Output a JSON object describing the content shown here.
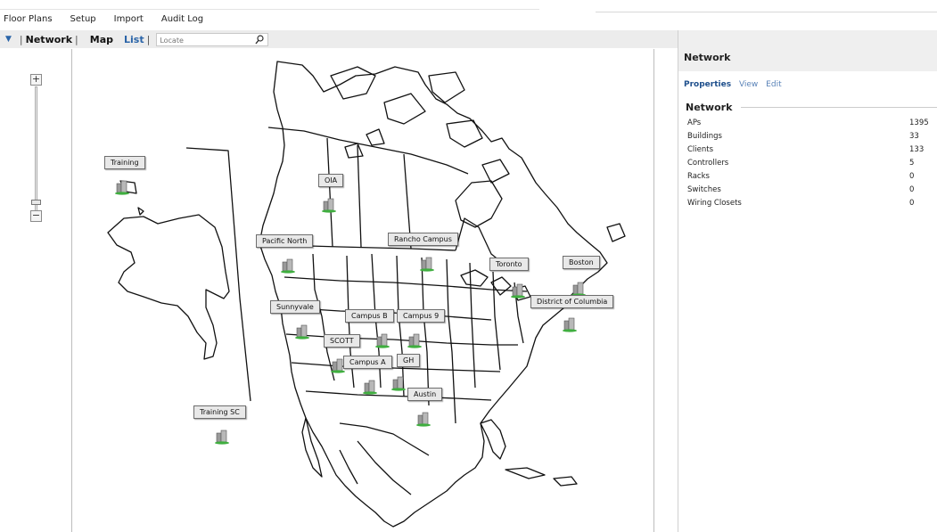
{
  "menu": {
    "items": [
      "Floor Plans",
      "Setup",
      "Import",
      "Audit Log"
    ]
  },
  "toolbar": {
    "network": "Network",
    "map": "Map",
    "list": "List",
    "separator": "|",
    "locate_placeholder": "Locate"
  },
  "map": {
    "zoom_in": "+",
    "zoom_out": "−",
    "locations": [
      {
        "label": "Training"
      },
      {
        "label": "OIA"
      },
      {
        "label": "Pacific North"
      },
      {
        "label": "Rancho Campus"
      },
      {
        "label": "Toronto"
      },
      {
        "label": "Boston"
      },
      {
        "label": "District of Columbia"
      },
      {
        "label": "Sunnyvale"
      },
      {
        "label": "Campus B"
      },
      {
        "label": "Campus 9"
      },
      {
        "label": "SCOTT"
      },
      {
        "label": "GH"
      },
      {
        "label": "Campus A"
      },
      {
        "label": "Austin"
      },
      {
        "label": "Training SC"
      }
    ]
  },
  "panel": {
    "title": "Network",
    "tabs": [
      "Properties",
      "View",
      "Edit"
    ],
    "section_title": "Network",
    "properties": [
      {
        "name": "APs",
        "value": "1395"
      },
      {
        "name": "Buildings",
        "value": "33"
      },
      {
        "name": "Clients",
        "value": "133"
      },
      {
        "name": "Controllers",
        "value": "5"
      },
      {
        "name": "Racks",
        "value": "0"
      },
      {
        "name": "Switches",
        "value": "0"
      },
      {
        "name": "Wiring Closets",
        "value": "0"
      }
    ]
  },
  "colors": {
    "accent": "#2a64a8",
    "building_green": "#3fae3f"
  }
}
